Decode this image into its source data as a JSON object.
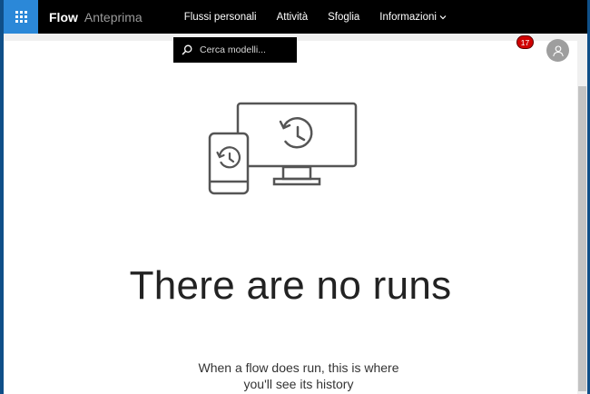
{
  "header": {
    "app_name": "Flow",
    "app_badge": "Anteprima",
    "nav": [
      {
        "label": "Flussi personali"
      },
      {
        "label": "Attività"
      },
      {
        "label": "Sfoglia"
      },
      {
        "label": "Informazioni"
      }
    ],
    "notification_count": "17"
  },
  "search": {
    "placeholder": "Cerca modelli..."
  },
  "empty_state": {
    "title": "There are no runs",
    "message_line1": "When a flow does run, this is where",
    "message_line2": "you'll see its history"
  },
  "colors": {
    "accent": "#2b88d8",
    "topbar": "#000000",
    "badge": "#d00000"
  }
}
